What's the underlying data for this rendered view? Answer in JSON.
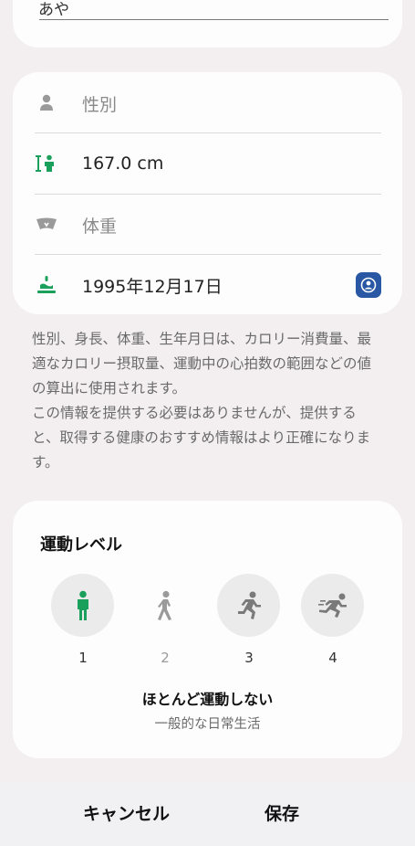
{
  "name_field": {
    "value": "あや"
  },
  "profile": {
    "gender": {
      "placeholder": "性別",
      "icon": "person-icon"
    },
    "height": {
      "value": "167.0 cm",
      "icon": "height-icon"
    },
    "weight": {
      "placeholder": "体重",
      "icon": "weight-icon"
    },
    "birthday": {
      "value": "1995年12月17日",
      "icon": "cake-icon"
    }
  },
  "info": {
    "line1": "性別、身長、体重、生年月日は、カロリー消費量、最適なカロリー摂取量、運動中の心拍数の範囲などの値の算出に使用されます。",
    "line2": "この情報を提供する必要はありませんが、提供すると、取得する健康のおすすめ情報はより正確になります。"
  },
  "activity": {
    "title": "運動レベル",
    "levels": [
      {
        "label": "1",
        "icon": "standing-person-icon",
        "selected": true
      },
      {
        "label": "2",
        "icon": "walking-person-icon",
        "selected": false
      },
      {
        "label": "3",
        "icon": "running-person-icon",
        "selected": false
      },
      {
        "label": "4",
        "icon": "sprinting-person-icon",
        "selected": false
      }
    ],
    "selected_name": "ほとんど運動しない",
    "selected_desc": "一般的な日常生活"
  },
  "buttons": {
    "cancel": "キャンセル",
    "save": "保存"
  },
  "colors": {
    "accent_green": "#1aa05a",
    "contact_blue": "#2957a4"
  }
}
